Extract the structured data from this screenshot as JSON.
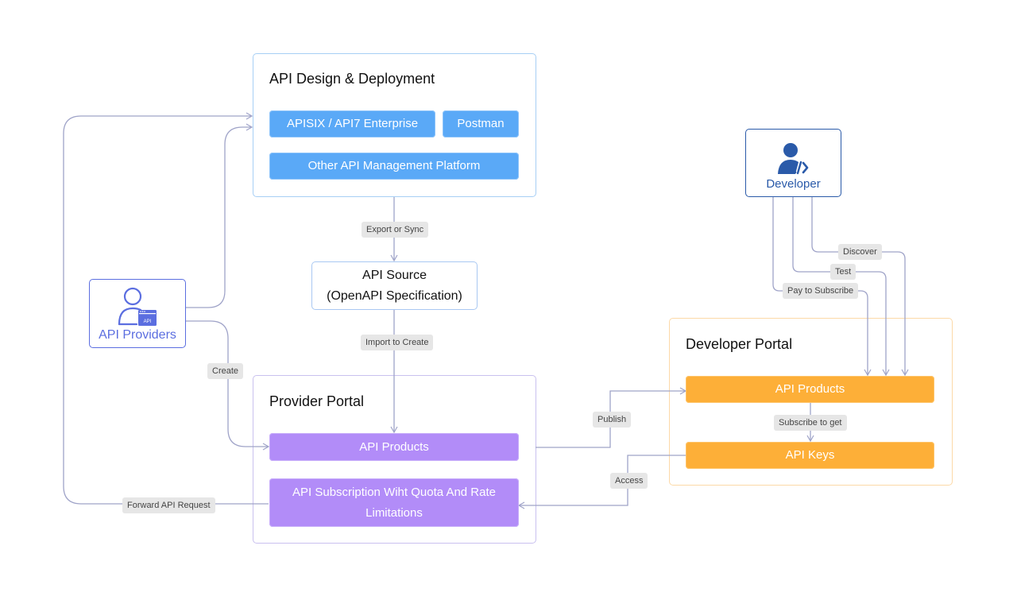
{
  "colors": {
    "connector": "#9fa3c8",
    "design_border": "#a7cff5",
    "provider_border": "#c9c1ef",
    "source_border": "#a9c8f2",
    "dev_portal_border": "#fcd9a8",
    "api_providers_color": "#5b6ee0",
    "developer_color": "#2a5aa9",
    "blue_pill": "#5aa9f7",
    "purple_pill": "#b28cf8",
    "orange_pill": "#fdaf38"
  },
  "api_design": {
    "title": "API Design & Deployment",
    "items": [
      "APISIX / API7 Enterprise",
      "Postman",
      "Other API Management Platform"
    ]
  },
  "api_source": {
    "line1": "API Source",
    "line2": "(OpenAPI Specification)"
  },
  "provider_portal": {
    "title": "Provider Portal",
    "items": [
      "API Products",
      "API Subscription Wiht Quota And Rate Limitations"
    ]
  },
  "developer_portal": {
    "title": "Developer Portal",
    "items": [
      "API Products",
      "API Keys"
    ]
  },
  "actors": {
    "api_providers": {
      "label": "API Providers",
      "icon": "user-api-icon",
      "badge": "API"
    },
    "developer": {
      "label": "Developer",
      "icon": "user-code-icon",
      "glyph": "</>"
    }
  },
  "edge_labels": {
    "export_or_sync": "Export or Sync",
    "import_to_create": "Import to Create",
    "create": "Create",
    "forward_api_request": "Forward API Request",
    "publish": "Publish",
    "access": "Access",
    "discover": "Discover",
    "test": "Test",
    "pay_to_subscribe": "Pay to Subscribe",
    "subscribe_to_get": "Subscribe to get"
  }
}
